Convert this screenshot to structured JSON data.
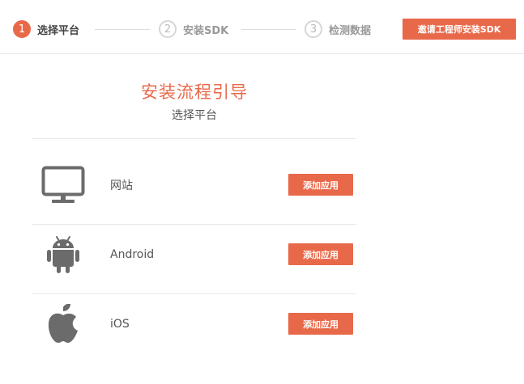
{
  "stepper": {
    "steps": [
      {
        "number": "1",
        "label": "选择平台",
        "state": "active"
      },
      {
        "number": "2",
        "label": "安装SDK",
        "state": "inactive"
      },
      {
        "number": "3",
        "label": "检测数据",
        "state": "inactive"
      }
    ],
    "invite_button": "邀请工程师安装SDK"
  },
  "heading": {
    "title": "安装流程引导",
    "subtitle": "选择平台"
  },
  "platforms": [
    {
      "label": "网站",
      "icon": "monitor-icon",
      "button": "添加应用"
    },
    {
      "label": "Android",
      "icon": "android-icon",
      "button": "添加应用"
    },
    {
      "label": "iOS",
      "icon": "apple-icon",
      "button": "添加应用"
    }
  ],
  "colors": {
    "accent": "#e8694a",
    "icon": "#6b6b6b",
    "divider": "#e8e8e8"
  }
}
